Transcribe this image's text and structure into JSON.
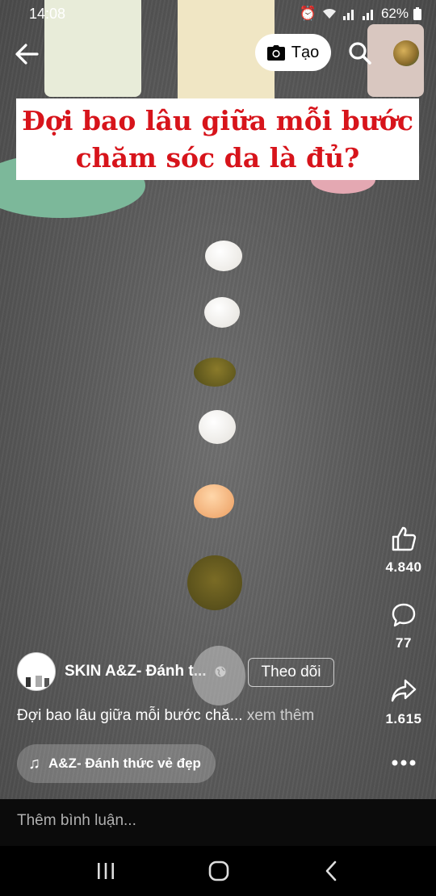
{
  "status_bar": {
    "time": "14:08",
    "battery": "62%"
  },
  "top_bar": {
    "create_label": "Tạo"
  },
  "video": {
    "caption_line1": "Đợi bao lâu giữa mỗi bước",
    "caption_line2": "chăm sóc da là đủ?"
  },
  "actions": {
    "likes": "4.840",
    "comments": "77",
    "shares": "1.615"
  },
  "post": {
    "page_name": "SKIN A&Z- Đánh t...",
    "follow_label": "Theo dõi",
    "description": "Đợi bao lâu giữa mỗi bước chă...",
    "see_more": "xem thêm",
    "music_text": "A&Z- Đánh thức vẻ đẹp"
  },
  "comment_bar": {
    "placeholder": "Thêm bình luận..."
  },
  "icons": [
    "back-arrow-icon",
    "camera-icon",
    "search-icon",
    "like-icon",
    "comment-icon",
    "share-icon",
    "more-icon",
    "music-note-icon",
    "globe-icon",
    "recents-icon",
    "home-icon",
    "nav-back-icon"
  ]
}
